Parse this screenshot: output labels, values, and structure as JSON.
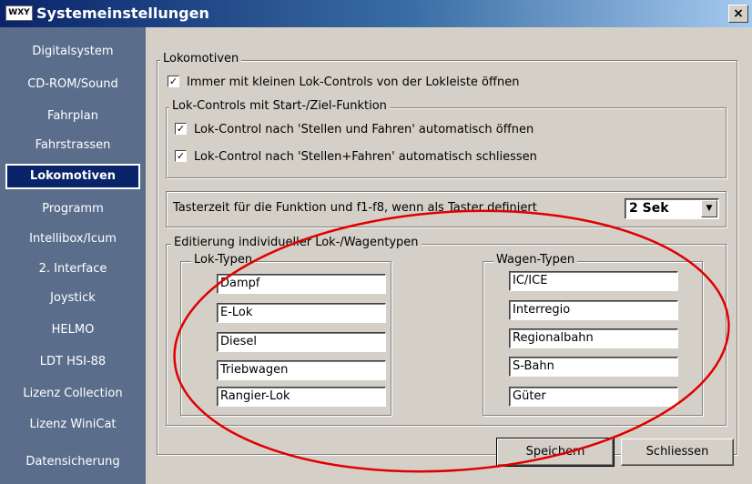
{
  "window": {
    "title": "Systemeinstellungen",
    "icon_text": "WXY",
    "close_label": "×"
  },
  "sidebar": {
    "items": [
      {
        "label": "Digitalsystem"
      },
      {
        "label": "CD-ROM/Sound"
      },
      {
        "label": "Fahrplan"
      },
      {
        "label": "Fahrstrassen"
      },
      {
        "label": "Lokomotiven",
        "active": true
      },
      {
        "label": "Programm"
      },
      {
        "label": "Intellibox/Icum"
      },
      {
        "label": "2. Interface"
      },
      {
        "label": "Joystick"
      },
      {
        "label": "HELMO"
      },
      {
        "label": "LDT HSI-88"
      },
      {
        "label": "Lizenz Collection"
      },
      {
        "label": "Lizenz WiniCat"
      },
      {
        "label": "Datensicherung"
      }
    ]
  },
  "lokomotiven": {
    "legend": "Lokomotiven",
    "open_small_controls": {
      "label": "Immer mit kleinen Lok-Controls von der Lokleiste öffnen",
      "checked": true
    },
    "start_ziel": {
      "legend": "Lok-Controls mit Start-/Ziel-Funktion",
      "auto_open": {
        "label": "Lok-Control nach 'Stellen und Fahren' automatisch öffnen",
        "checked": true
      },
      "auto_close": {
        "label": "Lok-Control nach 'Stellen+Fahren' automatisch schliessen",
        "checked": true
      }
    },
    "taster": {
      "label": "Tasterzeit für die Funktion und f1-f8, wenn als Taster definiert",
      "value": "2 Sek"
    },
    "editing": {
      "legend": "Editierung individueller Lok-/Wagentypen",
      "lok_legend": "Lok-Typen",
      "lok_types": [
        "Dampf",
        "E-Lok",
        "Diesel",
        "Triebwagen",
        "Rangier-Lok"
      ],
      "wagen_legend": "Wagen-Typen",
      "wagen_types": [
        "IC/ICE",
        "Interregio",
        "Regionalbahn",
        "S-Bahn",
        "Güter"
      ]
    }
  },
  "buttons": {
    "save": "Speichern",
    "close": "Schliessen"
  },
  "colors": {
    "sidebar_bg": "#5a6e8c",
    "active_item_bg": "#0a246a",
    "annotation_ellipse": "#e00000"
  }
}
